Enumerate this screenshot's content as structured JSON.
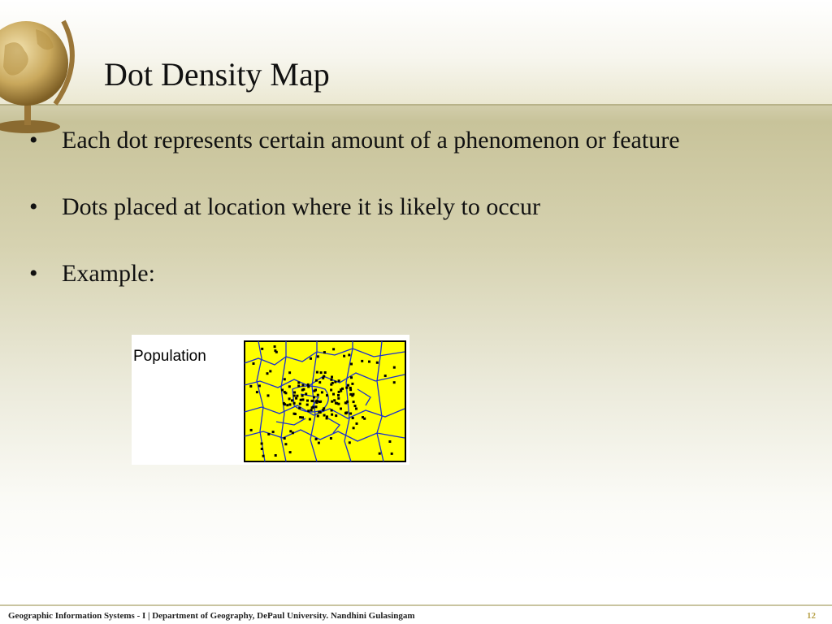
{
  "slide": {
    "title": "Dot Density Map",
    "bullets": [
      "Each dot represents certain  amount of a phenomenon or feature",
      "Dots placed at location where it is likely to occur",
      "Example:"
    ]
  },
  "example_map": {
    "legend_label": "Population",
    "fill_color": "#ffff00",
    "border_color": "#1a2fd0",
    "dot_color": "#000000"
  },
  "footer": {
    "text": "Geographic Information Systems - I | Department of Geography, DePaul University. Nandhini Gulasingam",
    "page_number": "12"
  }
}
